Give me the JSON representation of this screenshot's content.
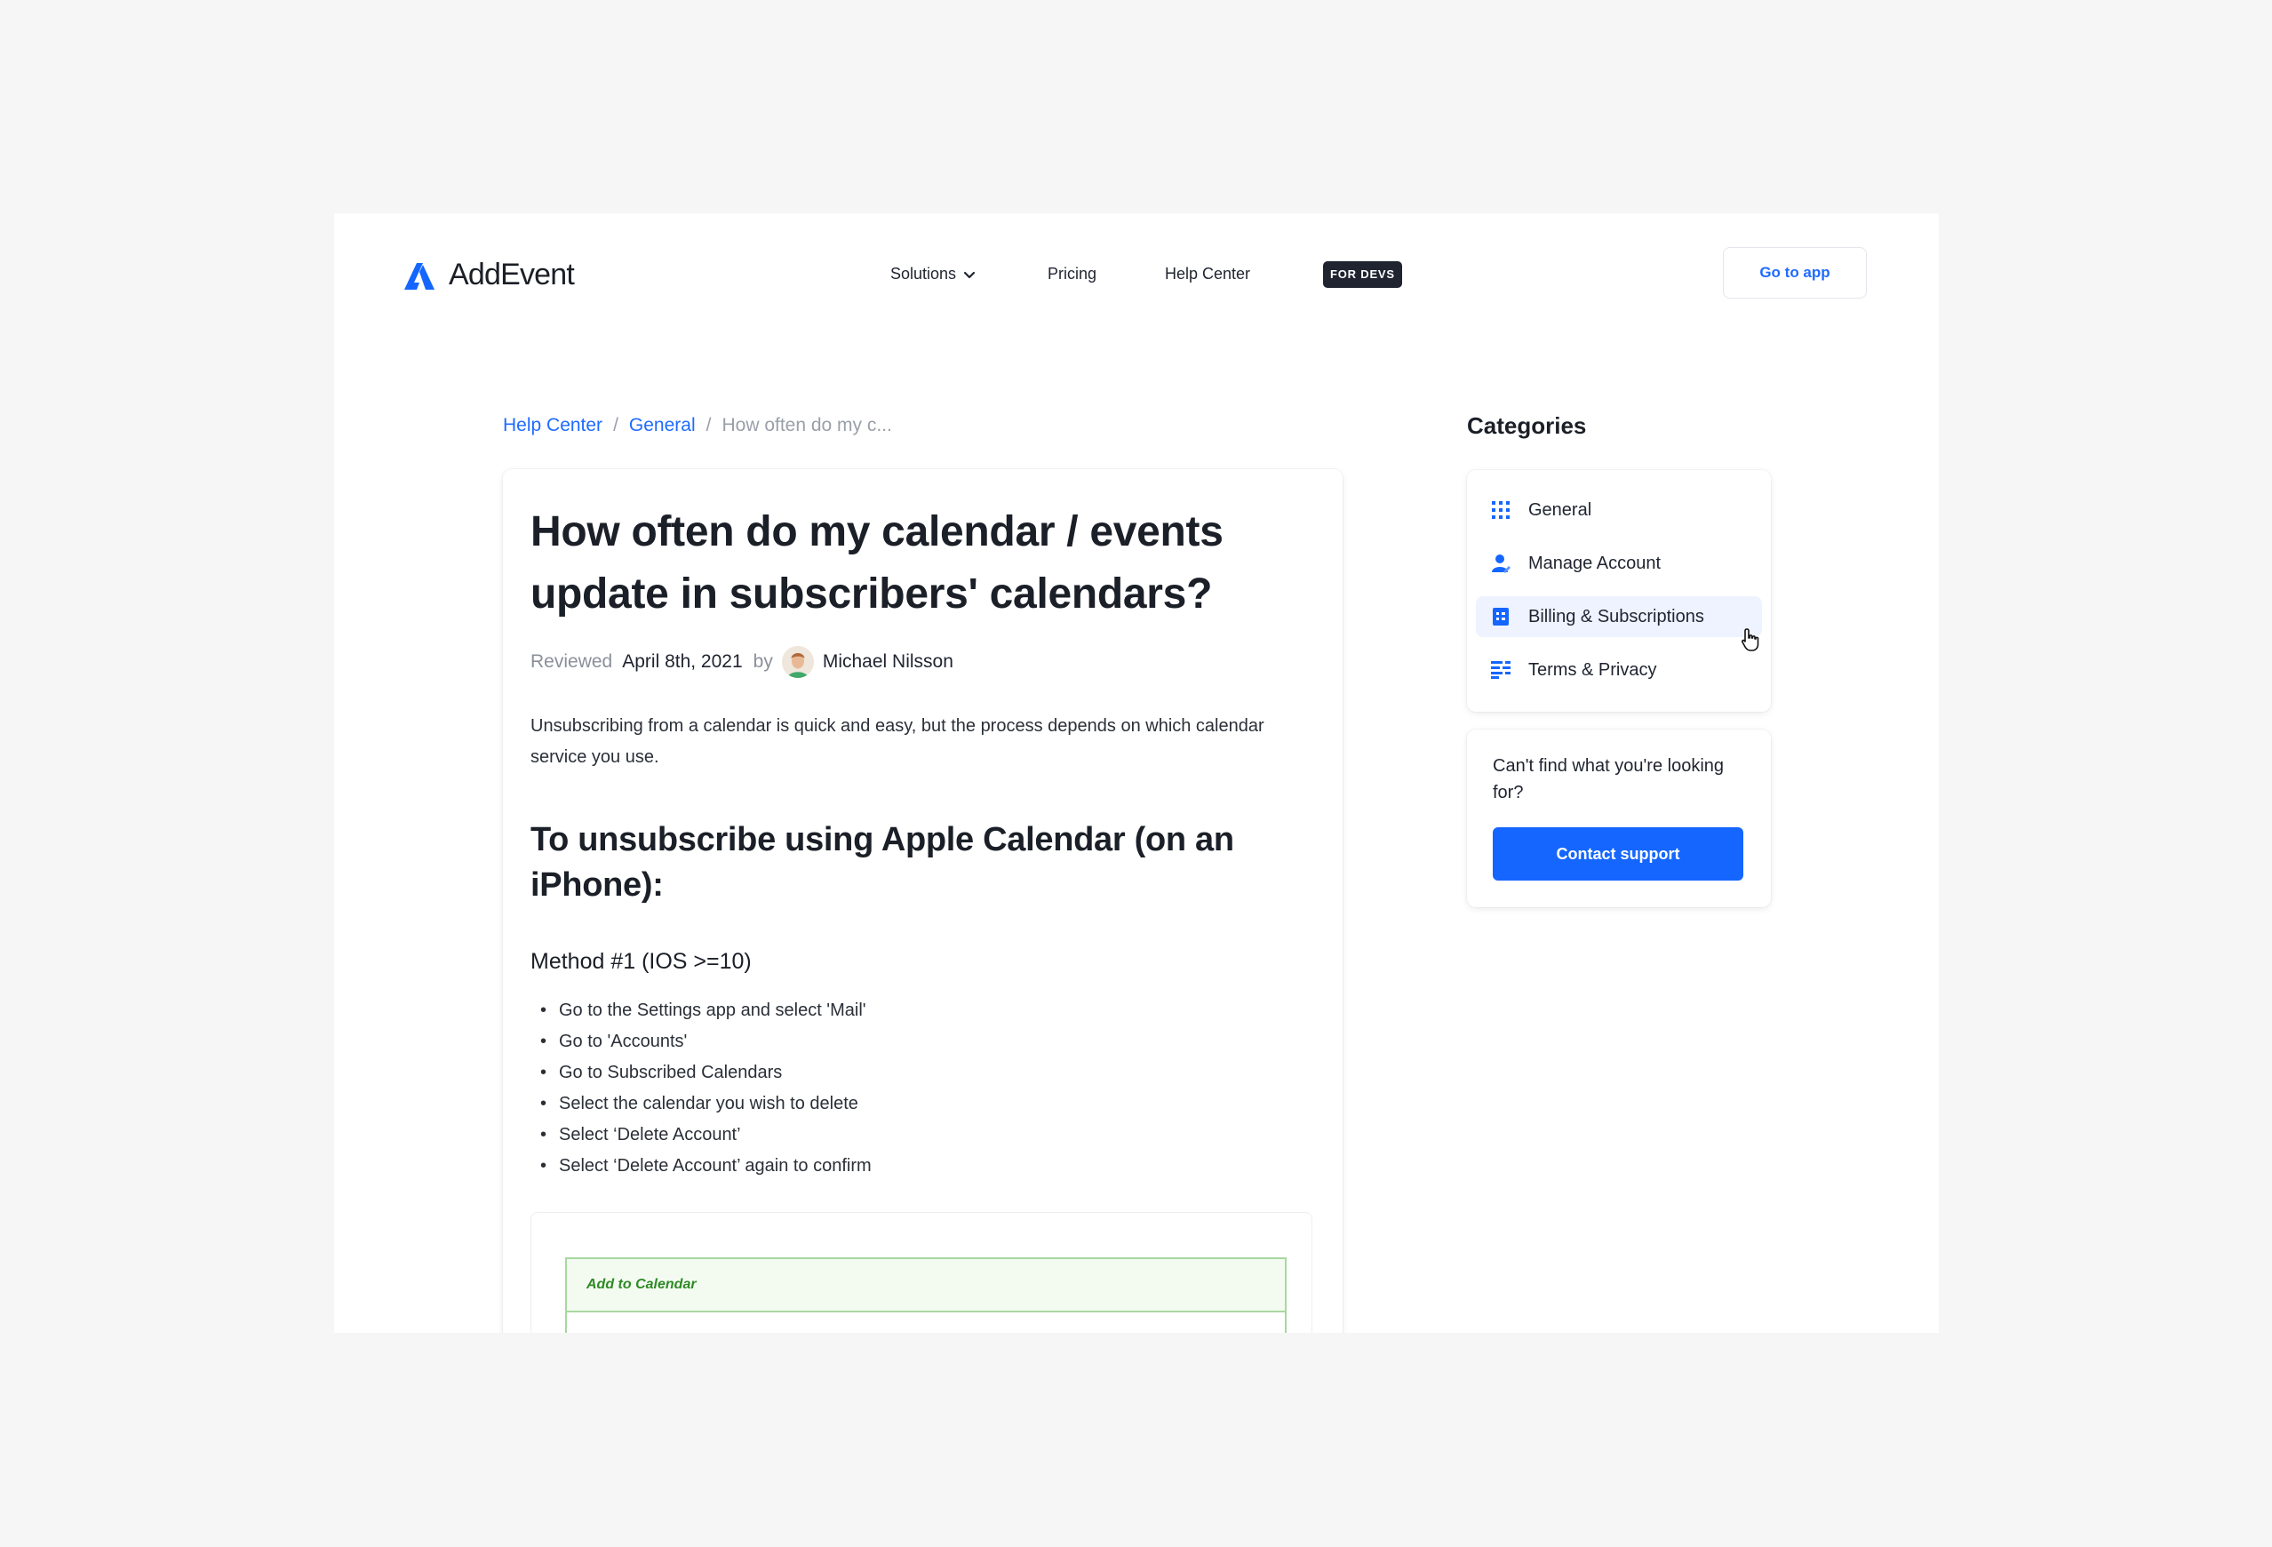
{
  "brand": {
    "name": "AddEvent",
    "accent_color": "#1466ff"
  },
  "nav": {
    "items": [
      {
        "label": "Solutions",
        "icon": "chevron-down-icon"
      },
      {
        "label": "Pricing"
      },
      {
        "label": "Help Center"
      }
    ],
    "badge": "FOR DEVS",
    "cta": "Go to app"
  },
  "breadcrumb": {
    "items": [
      "Help Center",
      "General"
    ],
    "separator": "/",
    "current": "How often do my c..."
  },
  "article": {
    "title": "How often do my calendar / events update in subscribers' calendars?",
    "meta": {
      "reviewed_label": "Reviewed",
      "date": "April 8th, 2021",
      "by_label": "by",
      "author": "Michael Nilsson"
    },
    "intro": "Unsubscribing from a calendar is quick and easy, but the process depends on which calendar service you use.",
    "section_heading": "To unsubscribe using Apple Calendar (on an iPhone):",
    "method_heading": "Method #1 (IOS >=10)",
    "steps": [
      "Go to the Settings app and select 'Mail'",
      "Go to 'Accounts'",
      "Go to Subscribed Calendars",
      "Select the calendar you wish to delete",
      "Select ‘Delete Account’",
      "Select ‘Delete Account’ again to confirm"
    ],
    "embed": {
      "header": "Add to Calendar"
    }
  },
  "sidebar": {
    "heading": "Categories",
    "categories": [
      {
        "label": "General",
        "icon": "grid-icon",
        "active": false
      },
      {
        "label": "Manage Account",
        "icon": "user-edit-icon",
        "active": false
      },
      {
        "label": "Billing & Subscriptions",
        "icon": "receipt-icon",
        "active": true
      },
      {
        "label": "Terms & Privacy",
        "icon": "list-lines-icon",
        "active": false
      }
    ],
    "help": {
      "text": "Can't find what you're looking for?",
      "button": "Contact support"
    }
  }
}
